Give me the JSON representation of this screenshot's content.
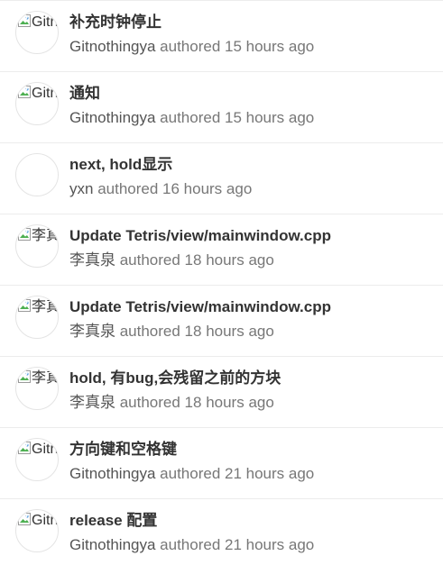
{
  "commits": [
    {
      "title": "补充时钟停止",
      "author": "Gitnothingya",
      "meta": " authored 15 hours ago",
      "avatar_alt": "Gitnothingya",
      "avatar_broken": true
    },
    {
      "title": "通知",
      "author": "Gitnothingya",
      "meta": " authored 15 hours ago",
      "avatar_alt": "Gitnothingya",
      "avatar_broken": true
    },
    {
      "title": "next, hold显示",
      "author": "yxn",
      "meta": " authored 16 hours ago",
      "avatar_alt": "",
      "avatar_broken": false
    },
    {
      "title": "Update Tetris/view/mainwindow.cpp",
      "author": "李真泉",
      "meta": " authored 18 hours ago",
      "avatar_alt": "李真泉",
      "avatar_broken": true
    },
    {
      "title": "Update Tetris/view/mainwindow.cpp",
      "author": "李真泉",
      "meta": " authored 18 hours ago",
      "avatar_alt": "李真泉",
      "avatar_broken": true
    },
    {
      "title": "hold, 有bug,会残留之前的方块",
      "author": "李真泉",
      "meta": " authored 18 hours ago",
      "avatar_alt": "李真泉",
      "avatar_broken": true
    },
    {
      "title": "方向键和空格键",
      "author": "Gitnothingya",
      "meta": " authored 21 hours ago",
      "avatar_alt": "Gitnothingya",
      "avatar_broken": true
    },
    {
      "title": "release 配置",
      "author": "Gitnothingya",
      "meta": " authored 21 hours ago",
      "avatar_alt": "Gitnothingya",
      "avatar_broken": true
    }
  ],
  "icons": {
    "broken_image": "broken-image-icon"
  },
  "colors": {
    "title": "#333333",
    "meta": "#777777",
    "divider": "#ececec"
  }
}
